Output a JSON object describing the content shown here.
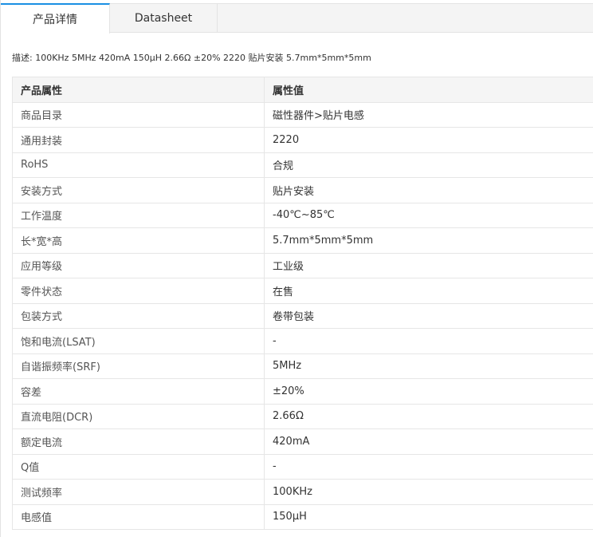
{
  "tabs": [
    {
      "label": "产品详情",
      "active": true
    },
    {
      "label": "Datasheet",
      "active": false
    }
  ],
  "description": "描述:  100KHz 5MHz 420mA 150μH 2.66Ω ±20% 2220 贴片安装 5.7mm*5mm*5mm",
  "table": {
    "headers": [
      "产品属性",
      "属性值"
    ],
    "rows": [
      {
        "key": "商品目录",
        "value": "磁性器件>贴片电感"
      },
      {
        "key": "通用封装",
        "value": "2220"
      },
      {
        "key": "RoHS",
        "value": "合规"
      },
      {
        "key": "安装方式",
        "value": "贴片安装"
      },
      {
        "key": "工作温度",
        "value": "-40℃~85℃"
      },
      {
        "key": "长*宽*高",
        "value": "5.7mm*5mm*5mm"
      },
      {
        "key": "应用等级",
        "value": "工业级"
      },
      {
        "key": "零件状态",
        "value": "在售"
      },
      {
        "key": "包装方式",
        "value": "卷带包装"
      },
      {
        "key": "饱和电流(LSAT)",
        "value": "-"
      },
      {
        "key": "自谐振频率(SRF)",
        "value": "5MHz"
      },
      {
        "key": "容差",
        "value": "±20%"
      },
      {
        "key": "直流电阻(DCR)",
        "value": "2.66Ω"
      },
      {
        "key": "额定电流",
        "value": "420mA"
      },
      {
        "key": "Q值",
        "value": "-"
      },
      {
        "key": "测试频率",
        "value": "100KHz"
      },
      {
        "key": "电感值",
        "value": "150μH"
      }
    ]
  },
  "colors": {
    "accent": "#1a8fe3",
    "header_bg": "#f5f5f5",
    "border": "#e6e6e6"
  }
}
